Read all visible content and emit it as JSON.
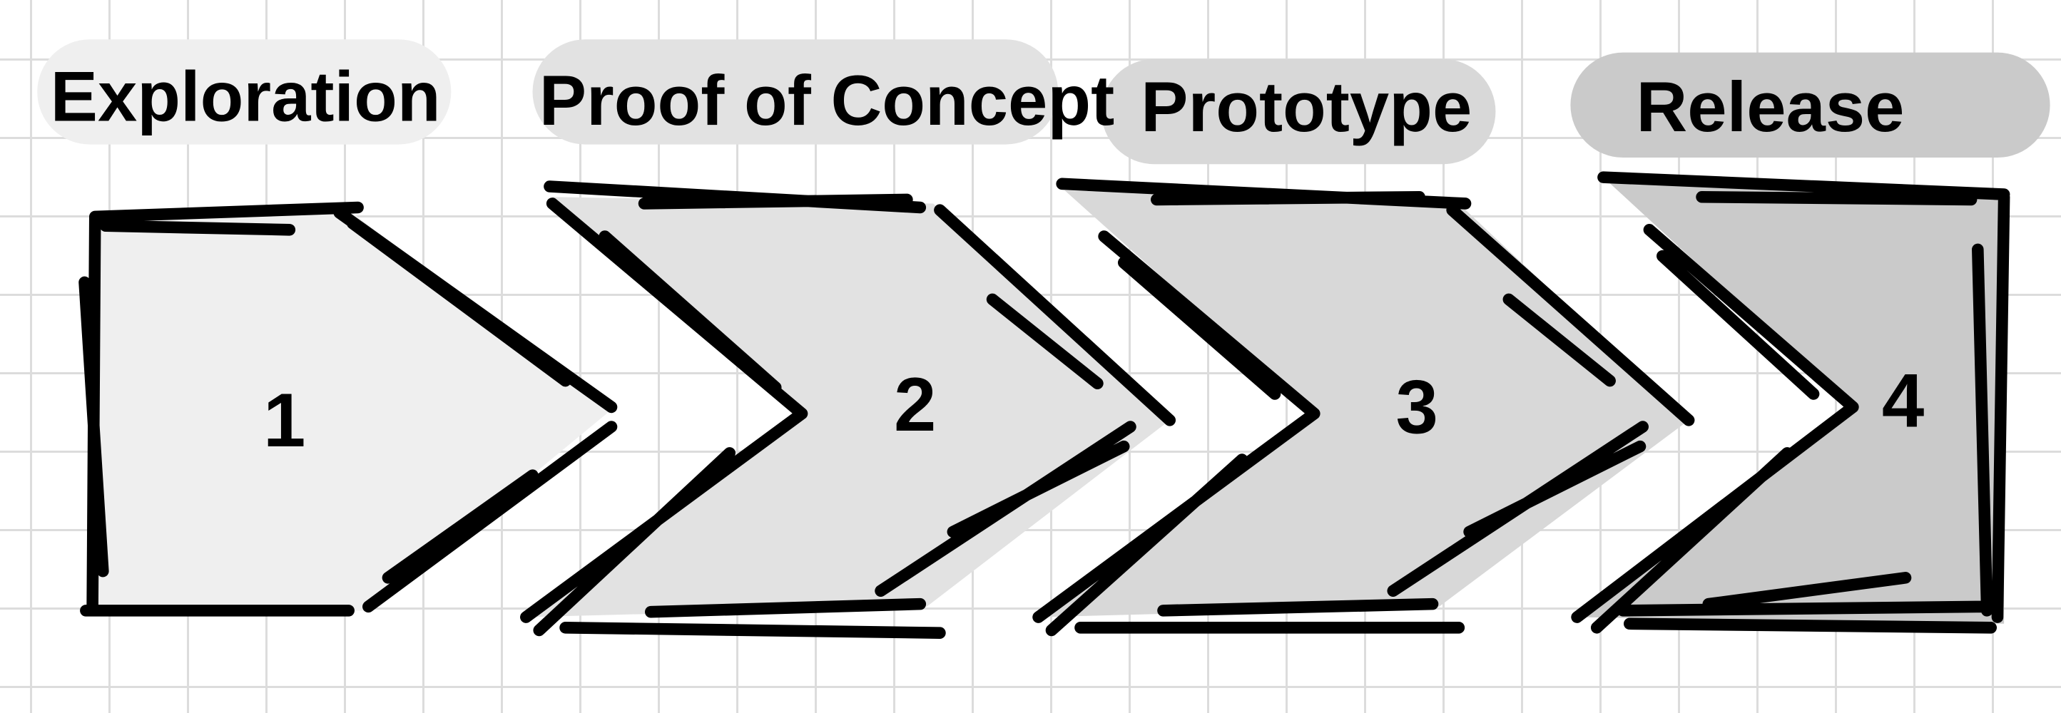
{
  "title": "Product development stages",
  "stages": [
    {
      "label": "Exploration",
      "number": "1",
      "fill": "#efefef"
    },
    {
      "label": "Proof of Concept",
      "number": "2",
      "fill": "#e2e2e2"
    },
    {
      "label": "Prototype",
      "number": "3",
      "fill": "#d8d8d8"
    },
    {
      "label": "Release",
      "number": "4",
      "fill": "#cacaca"
    }
  ]
}
